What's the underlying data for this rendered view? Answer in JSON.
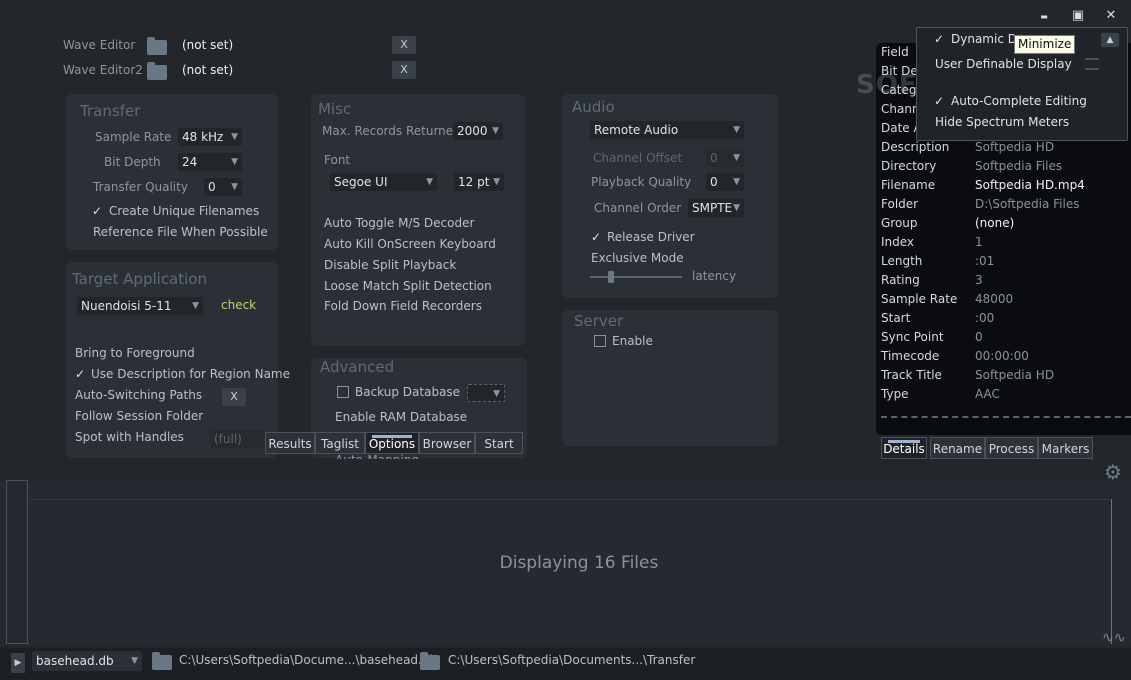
{
  "window": {
    "minimize": "▬",
    "maximize": "▣",
    "close": "✕"
  },
  "editors": [
    {
      "label": "Wave Editor",
      "value": "(not set)",
      "clear": "X"
    },
    {
      "label": "Wave Editor2",
      "value": "(not set)",
      "clear": "X"
    }
  ],
  "transfer": {
    "title": "Transfer",
    "sample_rate_label": "Sample Rate",
    "sample_rate": "48 kHz",
    "bit_depth_label": "Bit Depth",
    "bit_depth": "24",
    "quality_label": "Transfer  Quality",
    "quality": "0",
    "unique_filenames": "Create Unique Filenames",
    "reference_file": "Reference File When Possible"
  },
  "target": {
    "title": "Target Application",
    "app": "Nuendoisi 5-11",
    "check": "check",
    "bring_foreground": "Bring to Foreground",
    "use_description": "Use Description for Region Name",
    "auto_switch": "Auto-Switching Paths",
    "auto_switch_clear": "X",
    "follow_session": "Follow Session Folder",
    "spot_handles": "Spot with Handles",
    "spot_handles_value": "(full)"
  },
  "misc": {
    "title": "Misc",
    "max_records_label": "Max. Records Returned",
    "max_records": "2000",
    "font_label": "Font",
    "font": "Segoe UI",
    "font_size": "12 pt",
    "items": [
      "Auto Toggle M/S Decoder",
      "Auto Kill OnScreen Keyboard",
      "Disable Split Playback",
      "Loose Match Split Detection",
      "Fold Down Field Recorders"
    ]
  },
  "advanced": {
    "title": "Advanced",
    "backup": "Backup Database",
    "ram": "Enable RAM Database",
    "cut": "Auto-Mapping"
  },
  "audio": {
    "title": "Audio",
    "device": "Remote Audio",
    "channel_offset_label": "Channel Offset",
    "channel_offset": "0",
    "playback_quality_label": "Playback Quality",
    "playback_quality": "0",
    "channel_order_label": "Channel Order",
    "channel_order": "SMPTE",
    "release_driver": "Release Driver",
    "exclusive_mode": "Exclusive Mode",
    "latency": "latency"
  },
  "server": {
    "title": "Server",
    "enable": "Enable"
  },
  "tabs": [
    "Results",
    "Taglist",
    "Options",
    "Browser",
    "Start"
  ],
  "details": {
    "rows": [
      {
        "k": "Field",
        "v": ""
      },
      {
        "k": "Bit Dep",
        "v": ""
      },
      {
        "k": "Catego",
        "v": ""
      },
      {
        "k": "Chann",
        "v": ""
      },
      {
        "k": "Date A",
        "v": ""
      },
      {
        "k": "Description",
        "v": "Softpedia HD"
      },
      {
        "k": "Directory",
        "v": "Softpedia Files"
      },
      {
        "k": "Filename",
        "v": "Softpedia HD.mp4"
      },
      {
        "k": "Folder",
        "v": "D:\\Softpedia Files"
      },
      {
        "k": "Group",
        "v": "(none)"
      },
      {
        "k": "Index",
        "v": "1"
      },
      {
        "k": "Length",
        "v": ":01"
      },
      {
        "k": "Rating",
        "v": "3"
      },
      {
        "k": "Sample Rate",
        "v": "48000"
      },
      {
        "k": "Start",
        "v": ":00"
      },
      {
        "k": "Sync Point",
        "v": "0"
      },
      {
        "k": "Timecode",
        "v": "00:00:00"
      },
      {
        "k": "Track Title",
        "v": "Softpedia HD"
      },
      {
        "k": "Type",
        "v": "AAC"
      }
    ],
    "tabs": [
      "Details",
      "Rename",
      "Process",
      "Markers"
    ]
  },
  "context_menu": {
    "items": [
      "Dynamic Display",
      "User Definable Display",
      "Auto-Complete Editing",
      "Hide Spectrum Meters"
    ]
  },
  "tooltip": "Minimize",
  "watermark": "SOFTPEDIA",
  "status_text": "Displaying 16 Files",
  "statusbar": {
    "db": "basehead.db",
    "db_path": "C:\\Users\\Softpedia\\Docume...\\basehead.db",
    "transfer_path": "C:\\Users\\Softpedia\\Documents...\\Transfer"
  }
}
